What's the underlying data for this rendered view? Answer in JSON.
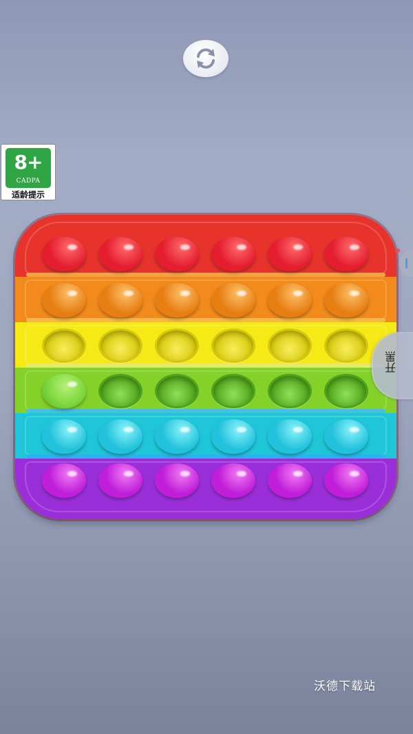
{
  "toolbar": {
    "refresh_icon": "refresh-icon"
  },
  "age_rating": {
    "age": "8+",
    "org": "CADPA",
    "hint": "适龄提示",
    "color": "#2fa543"
  },
  "board": {
    "rows": [
      {
        "color": "red",
        "band": "#e7332c",
        "divider": "#f3a24a",
        "bubble": "#e41d2f",
        "bubble_light": "#ff6a6a",
        "states": [
          "raised",
          "raised",
          "raised",
          "raised",
          "raised",
          "raised"
        ]
      },
      {
        "color": "orange",
        "band": "#f28a1c",
        "divider": "#f8b74a",
        "bubble": "#e67e12",
        "bubble_light": "#ffc06b",
        "states": [
          "raised",
          "raised",
          "raised",
          "raised",
          "raised",
          "raised"
        ]
      },
      {
        "color": "yellow",
        "band": "#f5ea16",
        "divider": "#e8e86a",
        "bubble": "#d6c80a",
        "bubble_light": "#f7ee5a",
        "states": [
          "pressed",
          "pressed",
          "pressed",
          "pressed",
          "pressed",
          "pressed"
        ]
      },
      {
        "color": "green",
        "band": "#84d12a",
        "divider": "#46bfe0",
        "bubble": "#4fa31a",
        "bubble_light": "#8fe056",
        "states": [
          "raised",
          "pressed",
          "pressed",
          "pressed",
          "pressed",
          "pressed"
        ]
      },
      {
        "color": "cyan",
        "band": "#1fc6d8",
        "divider": "#2ab4ee",
        "bubble": "#22c2dc",
        "bubble_light": "#8af2fa",
        "states": [
          "raised",
          "raised",
          "raised",
          "raised",
          "raised",
          "raised"
        ]
      },
      {
        "color": "purple",
        "band": "#9a2fd9",
        "divider": "#9a2fd9",
        "bubble": "#c01ed8",
        "bubble_light": "#f07cf4",
        "states": [
          "raised",
          "raised",
          "raised",
          "raised",
          "raised",
          "raised"
        ]
      }
    ]
  },
  "side_tab": {
    "label": "开黑"
  },
  "watermark": "沃德下载站"
}
